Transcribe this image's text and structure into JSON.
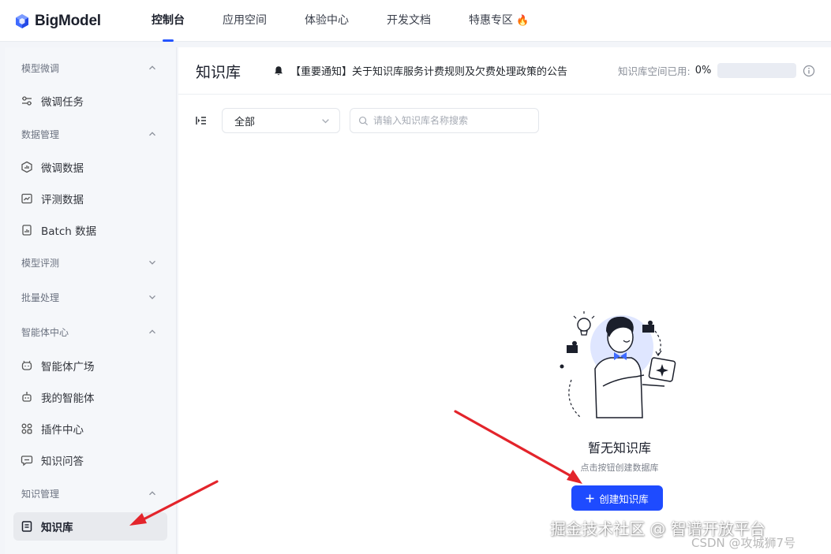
{
  "brand": {
    "name": "BigModel",
    "accent": "#2454ff"
  },
  "nav": {
    "items": [
      {
        "label": "控制台",
        "active": true
      },
      {
        "label": "应用空间"
      },
      {
        "label": "体验中心"
      },
      {
        "label": "开发文档"
      },
      {
        "label": "特惠专区",
        "icon": "fire-icon"
      }
    ]
  },
  "sidebar": {
    "sections": [
      {
        "label": "模型微调",
        "expanded": true,
        "items": [
          {
            "label": "微调任务",
            "icon": "sliders-icon"
          }
        ]
      },
      {
        "label": "数据管理",
        "expanded": true,
        "items": [
          {
            "label": "微调数据",
            "icon": "hexagon-chart-icon"
          },
          {
            "label": "评测数据",
            "icon": "line-chart-icon"
          },
          {
            "label": "Batch 数据",
            "icon": "document-stack-icon"
          }
        ]
      },
      {
        "label": "模型评测",
        "expanded": false,
        "items": []
      },
      {
        "label": "批量处理",
        "expanded": false,
        "items": []
      },
      {
        "label": "智能体中心",
        "expanded": true,
        "items": [
          {
            "label": "智能体广场",
            "icon": "robot-face-icon"
          },
          {
            "label": "我的智能体",
            "icon": "robot-icon"
          },
          {
            "label": "插件中心",
            "icon": "grid-plugin-icon"
          },
          {
            "label": "知识问答",
            "icon": "chat-bubble-icon"
          }
        ]
      },
      {
        "label": "知识管理",
        "expanded": true,
        "items": [
          {
            "label": "知识库",
            "icon": "book-icon",
            "active": true
          }
        ]
      }
    ]
  },
  "main": {
    "title": "知识库",
    "notice": "【重要通知】关于知识库服务计费规则及欠费处理政策的公告",
    "usage": {
      "label": "知识库空间已用:",
      "percent_text": "0%",
      "percent": 0
    },
    "filter": {
      "selected": "全部"
    },
    "search": {
      "placeholder": "请输入知识库名称搜索",
      "value": ""
    },
    "empty": {
      "title": "暂无知识库",
      "subtitle": "点击按钮创建数据库",
      "button": "创建知识库"
    }
  },
  "watermark": {
    "primary": "掘金技术社区 @ 智谱开放平台",
    "secondary": "CSDN @攻城狮7号"
  },
  "colors": {
    "annotation_arrow": "#e3242b",
    "primary_button": "#1e4bff"
  }
}
